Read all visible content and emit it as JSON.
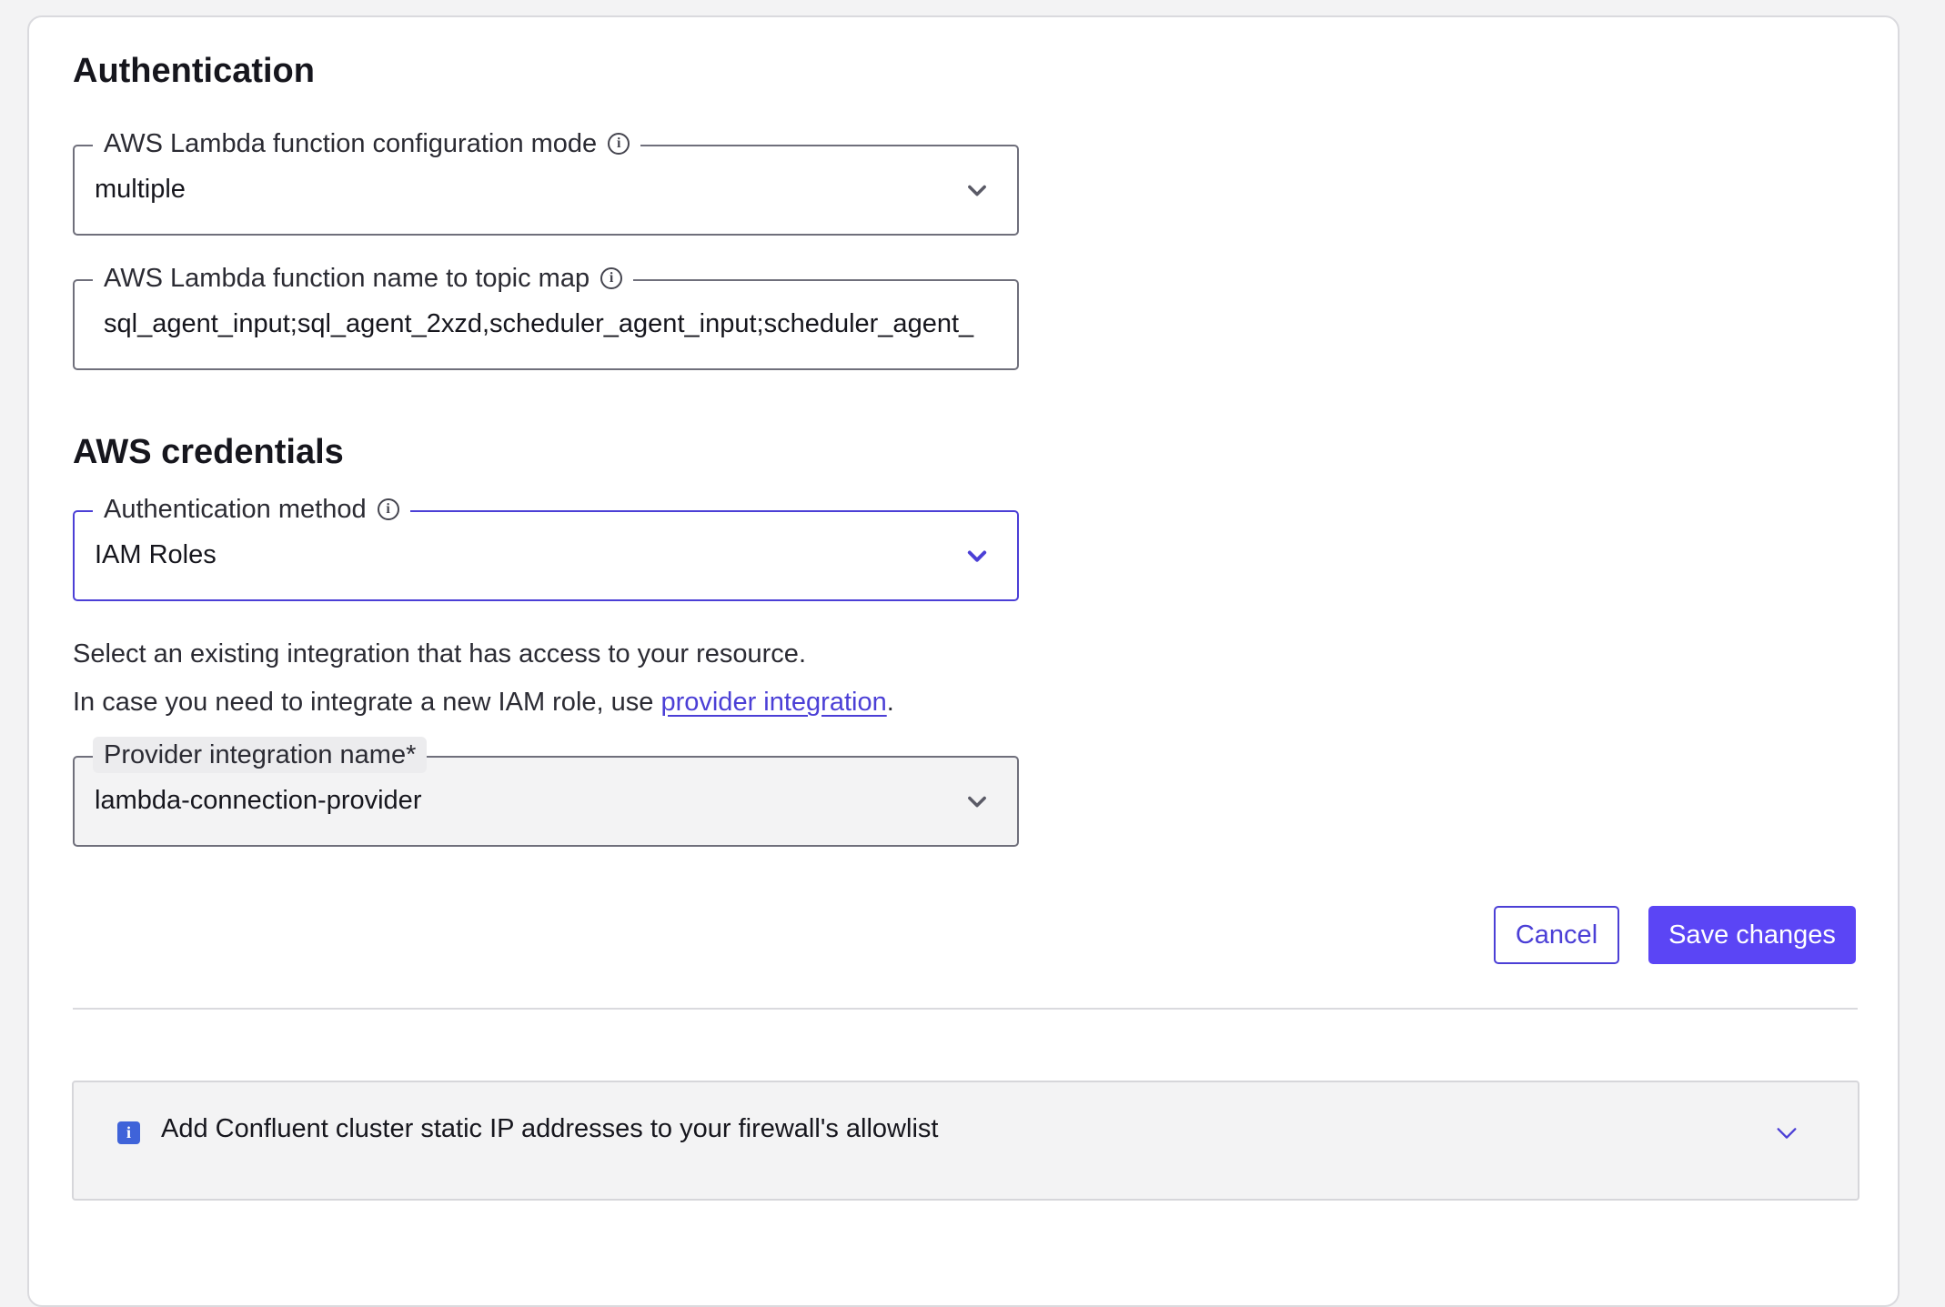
{
  "authentication": {
    "title": "Authentication",
    "config_mode": {
      "label": "AWS Lambda function configuration mode",
      "value": "multiple"
    },
    "topic_map": {
      "label": "AWS Lambda function name to topic map",
      "value": "sql_agent_input;sql_agent_2xzd,scheduler_agent_input;scheduler_agent_"
    }
  },
  "credentials": {
    "title": "AWS credentials",
    "auth_method": {
      "label": "Authentication method",
      "value": "IAM Roles"
    },
    "helper_line1": "Select an existing integration that has access to your resource.",
    "helper_line2_prefix": "In case you need to integrate a new IAM role, use ",
    "helper_link": "provider integration",
    "helper_line2_suffix": ".",
    "provider": {
      "label": "Provider integration name*",
      "value": "lambda-connection-provider"
    }
  },
  "actions": {
    "cancel_label": "Cancel",
    "save_label": "Save changes"
  },
  "accordion": {
    "title": "Add Confluent cluster static IP addresses to your firewall's allowlist",
    "icon": "info-icon"
  },
  "colors": {
    "accent": "#5b45f5",
    "link": "#4b3fd6",
    "info_badge": "#3f63d9"
  },
  "icons": {
    "info": "info-icon",
    "dropdown": "chevron-down-icon"
  }
}
